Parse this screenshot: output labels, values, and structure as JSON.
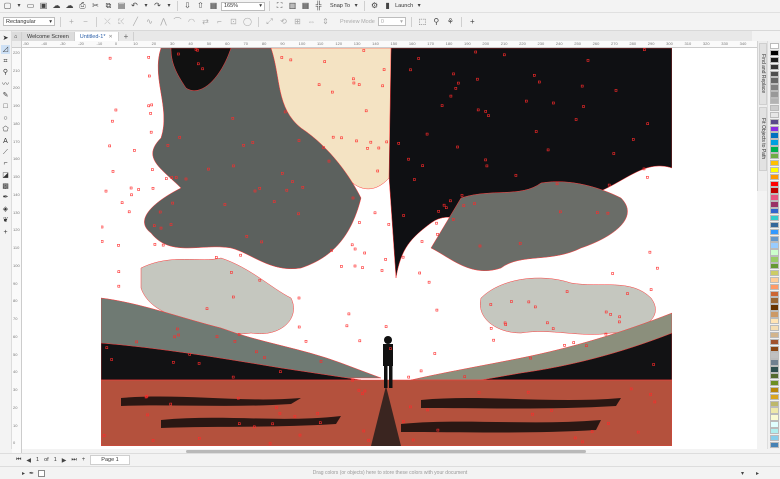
{
  "top_toolbar": {
    "zoom_value": "165%",
    "snap_label": "Snap To",
    "launch_label": "Launch"
  },
  "property_bar": {
    "shape_type": "Rectangular",
    "threshold_placeholder": "Preview Mode",
    "nudge_value": "0"
  },
  "doc_tabs": [
    {
      "label": "Welcome Screen"
    },
    {
      "label": "Untitled-1*"
    }
  ],
  "ruler": {
    "unit": "millimeters",
    "h_labels": [
      "-50",
      "-40",
      "-30",
      "-20",
      "-10",
      "0",
      "10",
      "20",
      "30",
      "40",
      "50",
      "60",
      "70",
      "80",
      "90",
      "100",
      "110",
      "120",
      "130",
      "140",
      "150",
      "160",
      "170",
      "180",
      "190",
      "200",
      "210",
      "220",
      "230",
      "240",
      "250",
      "260",
      "270",
      "280",
      "290",
      "300",
      "310",
      "320",
      "330",
      "340"
    ],
    "v_labels": [
      "220",
      "210",
      "200",
      "190",
      "180",
      "170",
      "160",
      "150",
      "140",
      "130",
      "120",
      "110",
      "100",
      "90",
      "80",
      "70",
      "60",
      "50",
      "40",
      "30",
      "20",
      "10",
      "0"
    ]
  },
  "docker_tabs": [
    "Find and Replace",
    "Fit Objects to Path"
  ],
  "page_nav": {
    "current": "1",
    "of_label": "of",
    "total": "1",
    "page_tab": "Page 1"
  },
  "status_bar": {
    "message": "Drag colors (or objects) here to store these colors with your document"
  },
  "palette_colors": [
    "#ffffff",
    "#000000",
    "#1a1a1a",
    "#333333",
    "#4d4d4d",
    "#666666",
    "#808080",
    "#999999",
    "#b3b3b3",
    "#cccccc",
    "#e6e6e6",
    "#5b4a8a",
    "#8a2be2",
    "#0070c0",
    "#00a0e0",
    "#00b050",
    "#70ad47",
    "#ffc000",
    "#ffff00",
    "#ff9900",
    "#ff0000",
    "#c00000",
    "#e75480",
    "#993366",
    "#3366cc",
    "#33cccc",
    "#336699",
    "#3399ff",
    "#6699cc",
    "#99ccff",
    "#ccffcc",
    "#99cc66",
    "#669933",
    "#cccc66",
    "#ffcc99",
    "#ff9966",
    "#cc6633",
    "#996633",
    "#663300",
    "#cc9966",
    "#ffe4b5",
    "#f5deb3",
    "#d2b48c",
    "#a0522d",
    "#8b4513",
    "#c0c0c0",
    "#708090",
    "#2f4f4f",
    "#556b2f",
    "#6b8e23",
    "#b8860b",
    "#daa520",
    "#bdb76b",
    "#eee8aa",
    "#fafad2",
    "#e0ffff",
    "#afeeee",
    "#87ceeb",
    "#4682b4"
  ]
}
